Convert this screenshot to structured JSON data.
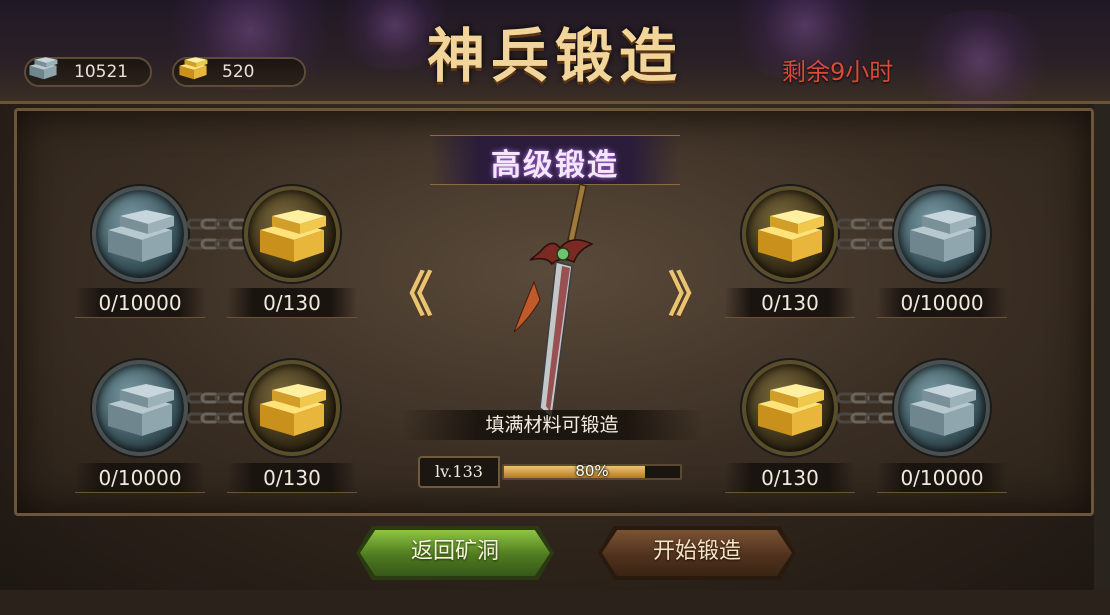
{
  "header": {
    "title": "神兵锻造",
    "remaining": "剩余9小时",
    "currencies": [
      {
        "icon": "iron-ingot-icon",
        "value": "10521"
      },
      {
        "icon": "gold-ingot-icon",
        "value": "520"
      }
    ]
  },
  "forge": {
    "grade": "高级锻造",
    "hint": "填满材料可锻造",
    "level": "lv.133",
    "progress_text": "80%",
    "progress": 0.8,
    "weapon_icon": "sword-icon",
    "prev_arrow": "《",
    "next_arrow": "》"
  },
  "materials": {
    "left_top": [
      {
        "type": "iron",
        "count": "0/10000"
      },
      {
        "type": "gold",
        "count": "0/130"
      }
    ],
    "left_bottom": [
      {
        "type": "iron",
        "count": "0/10000"
      },
      {
        "type": "gold",
        "count": "0/130"
      }
    ],
    "right_top": [
      {
        "type": "gold",
        "count": "0/130"
      },
      {
        "type": "iron",
        "count": "0/10000"
      }
    ],
    "right_bottom": [
      {
        "type": "gold",
        "count": "0/130"
      },
      {
        "type": "iron",
        "count": "0/10000"
      }
    ]
  },
  "buttons": {
    "back_label": "返回矿洞",
    "forge_label": "开始锻造"
  },
  "colors": {
    "title_gold": "#f1d59a",
    "remaining_red": "#d84a3a",
    "back_green": "#6fa032",
    "forge_brown": "#5f3d22"
  }
}
